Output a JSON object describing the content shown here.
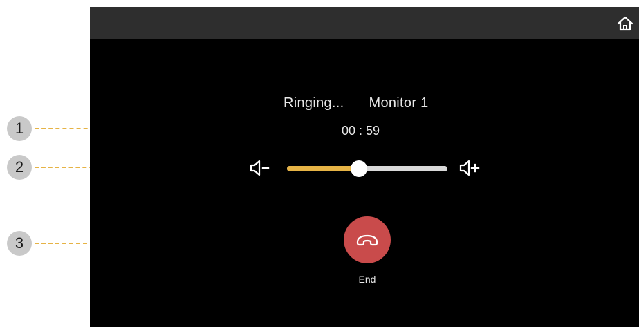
{
  "call": {
    "status": "Ringing...",
    "target": "Monitor 1",
    "timer": "00 : 59"
  },
  "volume": {
    "level": 0.45
  },
  "end_button": {
    "label": "End"
  },
  "callouts": [
    "1",
    "2",
    "3"
  ],
  "icons": {
    "home": "home-icon",
    "volume_down": "volume-down-icon",
    "volume_up": "volume-up-icon",
    "end_call": "hang-up-icon"
  },
  "colors": {
    "accent": "#e6b345",
    "end_call": "#c94b4b",
    "screen_bg": "#000000",
    "topbar_bg": "#2e2e2e",
    "callout_bg": "#c9c9c9"
  }
}
